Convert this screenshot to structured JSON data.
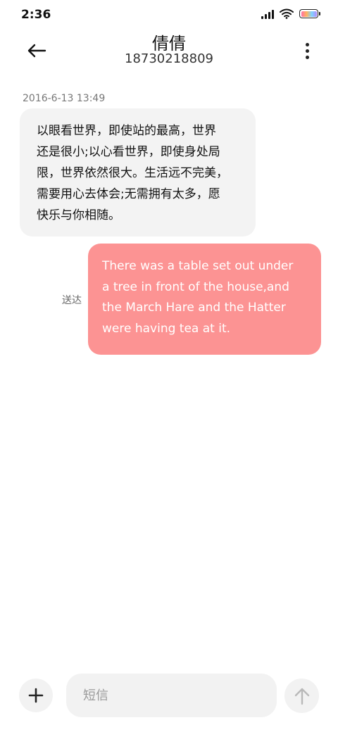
{
  "status_bar": {
    "time": "2:36",
    "battery_gradient": [
      "#ff6fa9",
      "#ffb35c",
      "#7fd4ff",
      "#b38bff"
    ]
  },
  "header": {
    "contact_name": "倩倩",
    "contact_number": "18730218809",
    "back_icon": "arrow-left-icon",
    "more_icon": "more-vertical-icon"
  },
  "messages": [
    {
      "direction": "incoming",
      "timestamp": "2016-6-13 13:49",
      "lines": [
        "以眼看世界，即使站的最高，世界",
        "还是很小;以心看世界，即使身处局",
        "限，世界依然很大。生活远不完美，",
        "需要用心去体会;无需拥有太多，愿",
        "快乐与你相随。"
      ],
      "bubble_color": "#f3f3f3"
    },
    {
      "direction": "outgoing",
      "status": "送达",
      "lines": [
        "There was a table set out under",
        "a tree in front of the house,and",
        "the March Hare and the Hatter",
        "were having tea at it."
      ],
      "bubble_color": "#fc9393"
    }
  ],
  "composer": {
    "placeholder": "短信",
    "value": "",
    "add_icon": "plus-icon",
    "send_icon": "arrow-up-icon"
  }
}
